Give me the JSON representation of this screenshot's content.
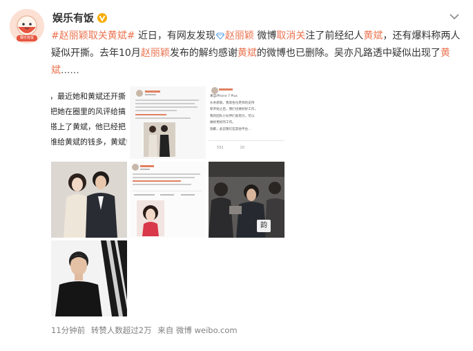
{
  "user": {
    "name": "娱乐有饭",
    "avatar_caption": "娱乐有饭"
  },
  "post": {
    "hashtag": "#赵丽颖取关黄斌#",
    "seg1": " 近日，有网友发现",
    "mention1": "赵丽颖",
    "seg2": " 微博",
    "seg3a": "取消",
    "seg3b": "关",
    "seg4": "注了前经纪人",
    "mention2": "黄斌",
    "seg5": "，还有爆料称两人疑似开撕。去年10月",
    "mention3": "赵丽颖",
    "seg6": "发布的解约感谢",
    "mention4": "黄斌",
    "seg7": "的微博也已删除。吴亦凡路透中疑似出现了",
    "mention5": "黄斌",
    "ellipsis": "......"
  },
  "images": {
    "img1_lines": [
      "，最近她和黄斌还开撕",
      "把她在圈里的风评给搞",
      "搭上了黄斌，他已经把",
      "维给黄斌的钱多，黄斌!"
    ],
    "img3_lines": [
      "来自iPhone 7 Plus",
      "头条新款。我等各位老师的支持",
      "新开始之后，我们也要好好工作，",
      "我的团队小伙伴们会努力，可以",
      "做好更好的工作。",
      "抱歉，此前我们在其他平台…"
    ],
    "img3_counts": [
      "531",
      "10"
    ],
    "img6_badge": "韵"
  },
  "footer": {
    "time": "11分钟前",
    "reposts": "转赞人数超过2万",
    "source": "来自 微博 weibo.com"
  },
  "colors": {
    "accent": "#eb7350",
    "text": "#333333",
    "meta": "#808080",
    "verified": "#f6ab00"
  }
}
